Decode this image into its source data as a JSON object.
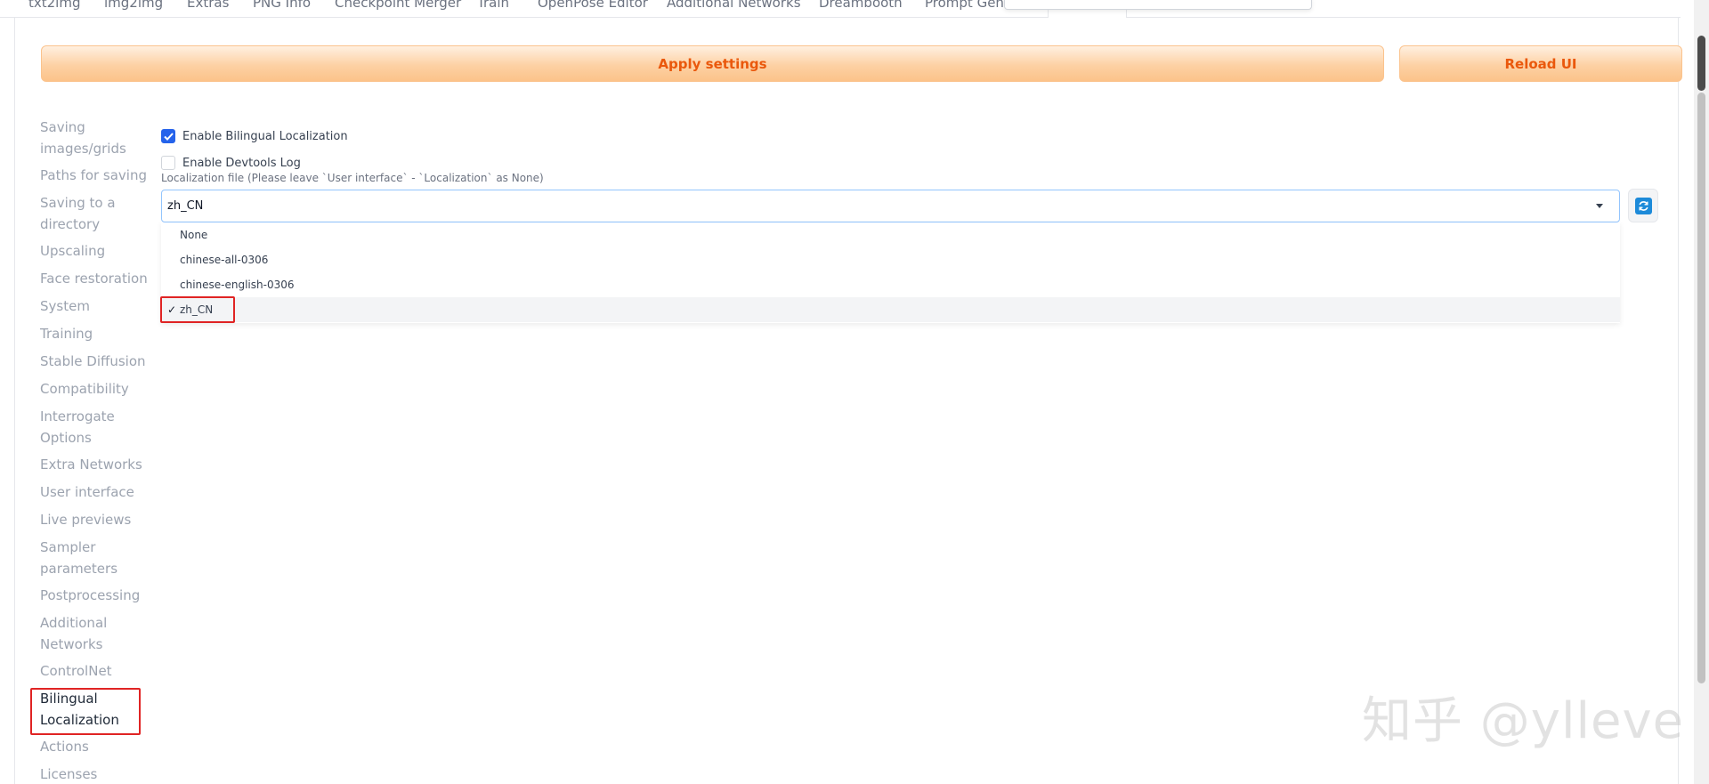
{
  "tabs": [
    {
      "label": "txt2img"
    },
    {
      "label": "img2img"
    },
    {
      "label": "Extras"
    },
    {
      "label": "PNG Info"
    },
    {
      "label": "Checkpoint Merger"
    },
    {
      "label": "Train"
    },
    {
      "label": "OpenPose Editor"
    },
    {
      "label": "Additional Networks"
    },
    {
      "label": "Dreambooth"
    },
    {
      "label": "Prompt Gene"
    }
  ],
  "toolbar": {
    "apply_label": "Apply settings",
    "reload_label": "Reload UI"
  },
  "sidebar": {
    "items": [
      {
        "label": "Saving images/grids"
      },
      {
        "label": "Paths for saving"
      },
      {
        "label": "Saving to a directory"
      },
      {
        "label": "Upscaling"
      },
      {
        "label": "Face restoration"
      },
      {
        "label": "System"
      },
      {
        "label": "Training"
      },
      {
        "label": "Stable Diffusion"
      },
      {
        "label": "Compatibility"
      },
      {
        "label": "Interrogate Options"
      },
      {
        "label": "Extra Networks"
      },
      {
        "label": "User interface"
      },
      {
        "label": "Live previews"
      },
      {
        "label": "Sampler parameters"
      },
      {
        "label": "Postprocessing"
      },
      {
        "label": "Additional Networks"
      },
      {
        "label": "ControlNet"
      },
      {
        "label": "Bilingual Localization"
      },
      {
        "label": "Actions"
      },
      {
        "label": "Licenses"
      }
    ],
    "active": "Bilingual Localization"
  },
  "settings": {
    "enable_bilingual_label": "Enable Bilingual Localization",
    "enable_bilingual_checked": true,
    "enable_devtools_label": "Enable Devtools Log",
    "enable_devtools_checked": false,
    "localization_file_label": "Localization file (Please leave `User interface` - `Localization` as None)",
    "localization_file_value": "zh_CN",
    "options": [
      {
        "label": "None"
      },
      {
        "label": "chinese-all-0306"
      },
      {
        "label": "chinese-english-0306"
      },
      {
        "label": "zh_CN"
      }
    ],
    "selected_tick": "✓"
  },
  "watermark": {
    "text": "知乎 @ylleve"
  },
  "colors": {
    "accent_orange": "#ea580c",
    "checkbox_blue": "#2563eb",
    "highlight_red": "#e02424",
    "refresh_blue": "#1d8ad9"
  }
}
